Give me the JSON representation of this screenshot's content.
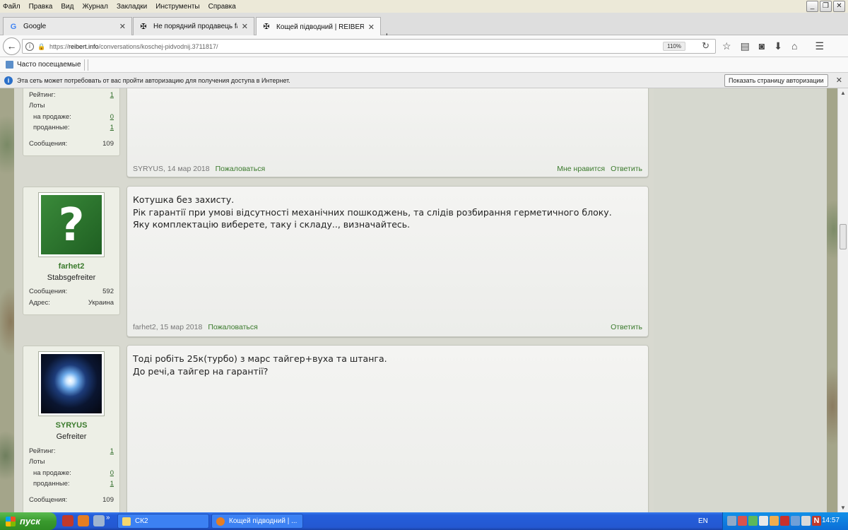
{
  "menu": [
    "Файл",
    "Правка",
    "Вид",
    "Журнал",
    "Закладки",
    "Инструменты",
    "Справка"
  ],
  "tabs": [
    {
      "label": "Google",
      "icon": "google-icon"
    },
    {
      "label": "Не порядний продавець far...",
      "icon": "iron-cross-icon"
    },
    {
      "label": "Кощей підводний | REIBERT...",
      "icon": "iron-cross-icon",
      "active": true
    }
  ],
  "nav": {
    "url_prefix": "https://",
    "url_domain": "reibert.info",
    "url_path": "/conversations/koschej-pidvodnij.3711817/",
    "zoom": "110%"
  },
  "bookmarks": {
    "item": "Часто посещаемые"
  },
  "notification": {
    "text": "Эта сеть может потребовать от вас пройти авторизацию для получения доступа в Интернет.",
    "button": "Показать страницу авторизации"
  },
  "posts": [
    {
      "stats": [
        {
          "label": "Рейтинг:",
          "value": "1",
          "link": true
        },
        {
          "label": "Лоты",
          "value": ""
        },
        {
          "label": "на продаже:",
          "value": "0",
          "link": true
        },
        {
          "label": "проданные:",
          "value": "1",
          "link": true
        },
        {
          "label": "Сообщения:",
          "value": "109",
          "link": false
        }
      ],
      "author": "SYRYUS",
      "date": "14 мар 2018",
      "report": "Пожаловаться",
      "like": "Мне нравится",
      "reply": "Ответить"
    },
    {
      "username": "farhet2",
      "rank": "Stabsgefreiter",
      "stats": [
        {
          "label": "Сообщения:",
          "value": "592"
        },
        {
          "label": "Адрес:",
          "value": "Украина"
        }
      ],
      "text": [
        "Котушка без захисту.",
        "Рік гарантії при умові відсутності механічних пошкоджень, та слідів розбирання герметичного блоку.",
        "Яку комплектацію виберете, таку і складу.., визначайтесь."
      ],
      "author": "farhet2",
      "date": "15 мар 2018",
      "report": "Пожаловаться",
      "reply": "Ответить"
    },
    {
      "username": "SYRYUS",
      "rank": "Gefreiter",
      "stats": [
        {
          "label": "Рейтинг:",
          "value": "1",
          "link": true
        },
        {
          "label": "Лоты",
          "value": ""
        },
        {
          "label": "на продаже:",
          "value": "0",
          "link": true
        },
        {
          "label": "проданные:",
          "value": "1",
          "link": true
        },
        {
          "label": "Сообщения:",
          "value": "109",
          "link": false
        }
      ],
      "text": [
        "Тоді робіть 25к(турбо) з марс тайгер+вуха та штанга.",
        "До речі,а тайгер на гарантії?"
      ]
    }
  ],
  "taskbar": {
    "start": "пуск",
    "windows": [
      {
        "label": "СК2",
        "icon": "folder-icon"
      },
      {
        "label": "Кощей підводний | ...",
        "icon": "firefox-icon"
      }
    ],
    "lang": "EN",
    "clock": "14:57"
  }
}
